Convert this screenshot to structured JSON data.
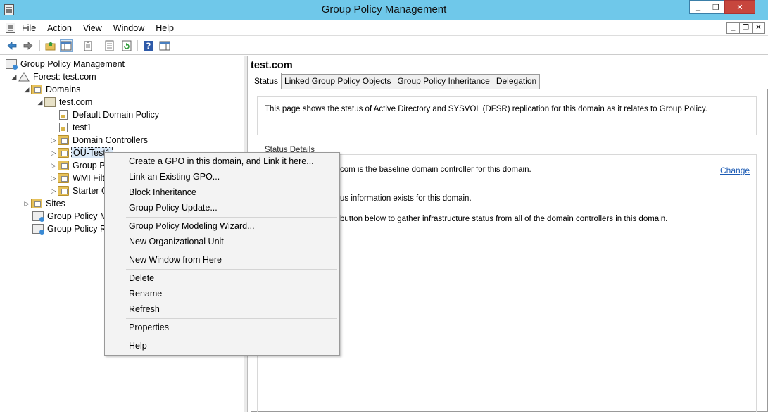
{
  "window": {
    "title": "Group Policy Management",
    "minimize": "_",
    "restore": "❐",
    "close": "✕"
  },
  "menubar": {
    "items": [
      "File",
      "Action",
      "View",
      "Window",
      "Help"
    ],
    "mdi_minimize": "_",
    "mdi_restore": "❐",
    "mdi_close": "✕"
  },
  "tree": {
    "root": "Group Policy Management",
    "forest": "Forest: test.com",
    "domains": "Domains",
    "domain": "test.com",
    "default_policy": "Default Domain Policy",
    "test1": "test1",
    "domain_controllers": "Domain Controllers",
    "ou_test": "OU-Test1",
    "group_policy_objects": "Group P",
    "wmi_filters": "WMI Filt",
    "starter_gpos": "Starter G",
    "sites": "Sites",
    "modeling": "Group Policy M",
    "results": "Group Policy R"
  },
  "right": {
    "title": "test.com",
    "tabs": [
      "Status",
      "Linked Group Policy Objects",
      "Group Policy Inheritance",
      "Delegation"
    ],
    "info": "This page shows the status of Active Directory and SYSVOL (DFSR) replication for this domain as it relates to Group Policy.",
    "status_legend": "Status Details",
    "baseline": "com is the baseline domain controller for this domain.",
    "change": "Change",
    "no_info": "us information exists for this domain.",
    "gather": "button below to gather infrastructure status from all of the domain controllers in this domain."
  },
  "context_menu": {
    "create_gpo": "Create a GPO in this domain, and Link it here...",
    "link_existing": "Link an Existing GPO...",
    "block_inheritance": "Block Inheritance",
    "gp_update": "Group Policy Update...",
    "modeling_wizard": "Group Policy Modeling Wizard...",
    "new_ou": "New Organizational Unit",
    "new_window": "New Window from Here",
    "delete": "Delete",
    "rename": "Rename",
    "refresh": "Refresh",
    "properties": "Properties",
    "help": "Help"
  },
  "colors": {
    "titlebar": "#6fc8ea",
    "close_button": "#c7463d",
    "link": "#1d5cb5"
  }
}
